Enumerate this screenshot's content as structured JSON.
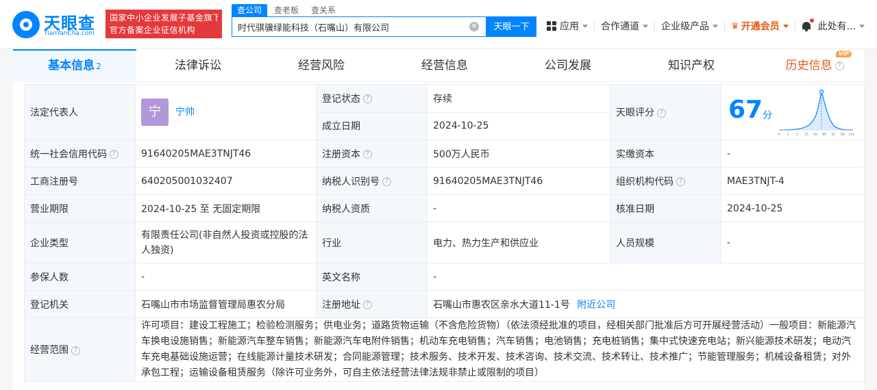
{
  "header": {
    "logo_title": "天眼查",
    "logo_sub": "TianYanCha.com",
    "badge_line1": "国家中小企业发展子基金旗下",
    "badge_line2": "官方备案企业征信机构",
    "search_tabs": [
      "查公司",
      "查老板",
      "查关系"
    ],
    "search_value": "时代骐骥绿能科技（石嘴山）有限公司",
    "search_button": "天眼一下",
    "nav": {
      "apps": "应用",
      "cooperation": "合作通道",
      "enterprise": "企业级产品",
      "vip": "开通会员",
      "user": "此处有..."
    }
  },
  "tabs": {
    "basic": "基本信息",
    "basic_count": "2",
    "legal": "法律诉讼",
    "risk": "经营风险",
    "ops": "经营信息",
    "dev": "公司发展",
    "ip": "知识产权",
    "history": "历史信息",
    "vip_tag": "VIP"
  },
  "info": {
    "legal_rep_label": "法定代表人",
    "legal_rep_avatar": "宁",
    "legal_rep_name": "宁帅",
    "reg_status_label": "登记状态",
    "reg_status": "存续",
    "found_date_label": "成立日期",
    "found_date": "2024-10-25",
    "score_label": "天眼评分",
    "score": "67",
    "score_unit": "分",
    "score_axis": [
      "0",
      "1",
      "3",
      "15",
      "50",
      "85",
      "97",
      "99",
      "100"
    ],
    "credit_code_label": "统一社会信用代码",
    "credit_code": "91640205MAE3TNJT46",
    "reg_capital_label": "注册资本",
    "reg_capital": "500万人民币",
    "paid_capital_label": "实缴资本",
    "paid_capital": "-",
    "biz_reg_no_label": "工商注册号",
    "biz_reg_no": "640205001032407",
    "taxpayer_id_label": "纳税人识别号",
    "taxpayer_id": "91640205MAE3TNJT46",
    "org_code_label": "组织机构代码",
    "org_code": "MAE3TNJT-4",
    "term_label": "营业期限",
    "term": "2024-10-25 至 无固定期限",
    "taxpayer_qual_label": "纳税人资质",
    "taxpayer_qual": "-",
    "approve_date_label": "核准日期",
    "approve_date": "2024-10-25",
    "type_label": "企业类型",
    "type": "有限责任公司(非自然人投资或控股的法人独资)",
    "industry_label": "行业",
    "industry": "电力、热力生产和供应业",
    "staff_size_label": "人员规模",
    "staff_size": "-",
    "insured_label": "参保人数",
    "insured": "-",
    "english_name_label": "英文名称",
    "english_name": "-",
    "reg_authority_label": "登记机关",
    "reg_authority": "石嘴山市市场监督管理局惠农分局",
    "reg_address_label": "注册地址",
    "reg_address": "石嘴山市惠农区亲水大道11-1号",
    "nearby_link": "附近公司",
    "scope_label": "经营范围",
    "scope": "许可项目：建设工程施工；检验检测服务；供电业务；道路货物运输（不含危险货物）（依法须经批准的项目，经相关部门批准后方可开展经营活动）一般项目：新能源汽车换电设施销售；新能源汽车整车销售；新能源汽车电附件销售；机动车充电销售；汽车销售；电池销售；充电桩销售；集中式快速充电站；新兴能源技术研发；电动汽车充电基础设施运营；在线能源计量技术研发；合同能源管理；技术服务、技术开发、技术咨询、技术交流、技术转让、技术推广；节能管理服务；机械设备租赁；对外承包工程；运输设备租赁服务（除许可业务外，可自主依法经营法律法规非禁止或限制的项目）"
  },
  "colors": {
    "brand": "#0084ff",
    "status_active": "#1fa05a",
    "vip": "#e35b12",
    "badge": "#e4393c"
  }
}
